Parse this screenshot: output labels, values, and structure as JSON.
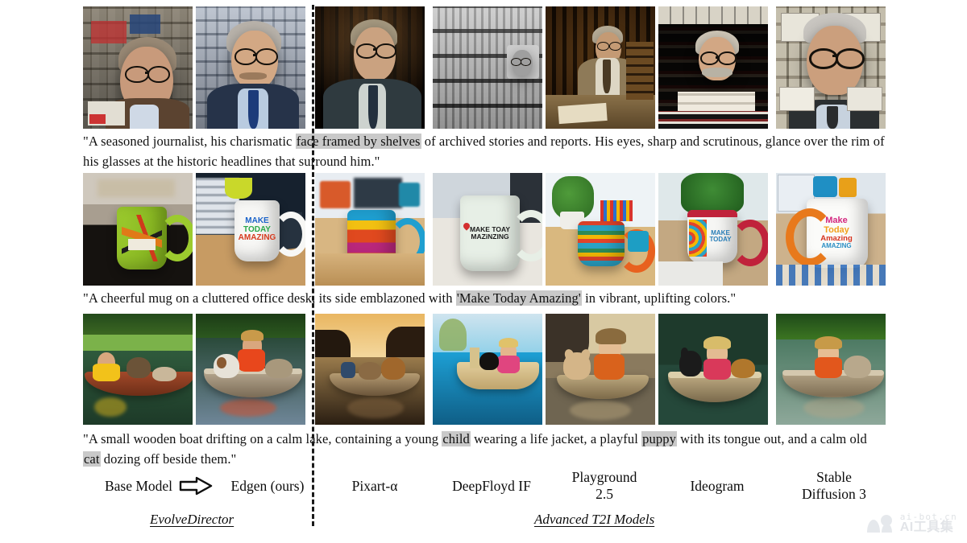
{
  "figure": {
    "rows": [
      {
        "id": "row-journalist",
        "caption_parts": [
          {
            "t": "\"A seasoned journalist, his charismatic ",
            "hl": false
          },
          {
            "t": "face framed by shelves",
            "hl": true
          },
          {
            "t": " of archived stories and reports. His eyes, sharp and scrutinous, glance over the rim of his glasses at the historic headlines that surround him.\"",
            "hl": false
          }
        ],
        "caption_plain": "\"A seasoned journalist, his charismatic face framed by shelves of archived stories and reports. His eyes, sharp and scrutinous, glance over the rim of his glasses at the historic headlines that surround him.\"",
        "cells": [
          {
            "alt": "journalist-base-model"
          },
          {
            "alt": "journalist-edgen-ours"
          },
          {
            "alt": "journalist-pixart-alpha"
          },
          {
            "alt": "journalist-deepfloyd-if"
          },
          {
            "alt": "journalist-playground-25"
          },
          {
            "alt": "journalist-ideogram"
          },
          {
            "alt": "journalist-stable-diffusion-3"
          }
        ]
      },
      {
        "id": "row-mug",
        "caption_parts": [
          {
            "t": "\"A cheerful mug on a cluttered office desk, its side emblazoned with ",
            "hl": false
          },
          {
            "t": "'Make Today Amazing'",
            "hl": true
          },
          {
            "t": " in vibrant, uplifting colors.\"",
            "hl": false
          }
        ],
        "caption_plain": "\"A cheerful mug on a cluttered office desk, its side emblazoned with 'Make Today Amazing' in vibrant, uplifting colors.\"",
        "cells": [
          {
            "alt": "mug-base-model",
            "mug_text": ""
          },
          {
            "alt": "mug-edgen-ours",
            "mug_text": "MAKE TODAY AMAZING"
          },
          {
            "alt": "mug-pixart-alpha",
            "mug_text": ""
          },
          {
            "alt": "mug-deepfloyd-if",
            "mug_text": "MAKE TOAY MAZINZING"
          },
          {
            "alt": "mug-playground-25",
            "mug_text": ""
          },
          {
            "alt": "mug-ideogram",
            "mug_text": "MAKE TODAY"
          },
          {
            "alt": "mug-stable-diffusion-3",
            "mug_text": "Make Today Amazing AMAZING"
          }
        ]
      },
      {
        "id": "row-boat",
        "caption_parts": [
          {
            "t": "\"A small wooden boat drifting on a calm lake, containing a young ",
            "hl": false
          },
          {
            "t": "child",
            "hl": true
          },
          {
            "t": " wearing a life jacket, a playful ",
            "hl": false
          },
          {
            "t": "puppy",
            "hl": true
          },
          {
            "t": " with its tongue out, and a calm old ",
            "hl": false
          },
          {
            "t": "cat",
            "hl": true
          },
          {
            "t": " dozing off beside them.\"",
            "hl": false
          }
        ],
        "caption_plain": "\"A small wooden boat drifting on a calm lake, containing a young child wearing a life jacket, a playful puppy with its tongue out, and a calm old cat dozing off beside them.\"",
        "cells": [
          {
            "alt": "boat-base-model"
          },
          {
            "alt": "boat-edgen-ours"
          },
          {
            "alt": "boat-pixart-alpha"
          },
          {
            "alt": "boat-deepfloyd-if"
          },
          {
            "alt": "boat-playground-25"
          },
          {
            "alt": "boat-ideogram"
          },
          {
            "alt": "boat-stable-diffusion-3"
          }
        ]
      }
    ],
    "column_labels": {
      "base_model": "Base Model",
      "arrow": "arrow-right-outline",
      "edgen": "Edgen (ours)",
      "pixart": "Pixart-α",
      "deepfloyd": "DeepFloyd IF",
      "playground": "Playground\n2.5",
      "playground_l1": "Playground",
      "playground_l2": "2.5",
      "ideogram": "Ideogram",
      "sd3_l1": "Stable",
      "sd3_l2": "Diffusion 3"
    },
    "group_labels": {
      "left": "EvolveDirector",
      "right": "Advanced T2I Models"
    },
    "watermark": {
      "line1": "ai-bot.cn",
      "line2": "AI工具集"
    },
    "colors": {
      "highlight": "#c9c9c9",
      "divider": "#1a1a1a",
      "text": "#0c0c0c",
      "watermark": "#dfe2e6"
    }
  }
}
